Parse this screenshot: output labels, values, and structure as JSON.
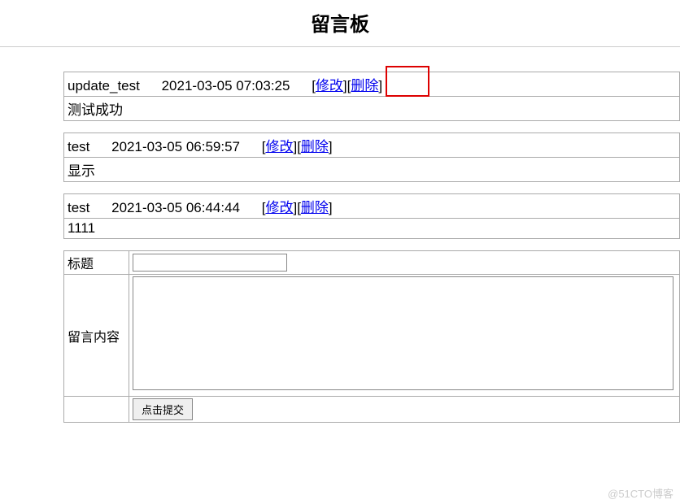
{
  "page": {
    "title": "留言板"
  },
  "messages": [
    {
      "author": "update_test",
      "datetime": "2021-03-05 07:03:25",
      "edit_label": "修改",
      "delete_label": "删除",
      "body": "测试成功",
      "highlight_delete": true
    },
    {
      "author": "test",
      "datetime": "2021-03-05 06:59:57",
      "edit_label": "修改",
      "delete_label": "删除",
      "body": "显示",
      "highlight_delete": false
    },
    {
      "author": "test",
      "datetime": "2021-03-05 06:44:44",
      "edit_label": "修改",
      "delete_label": "删除",
      "body": "1111",
      "highlight_delete": false
    }
  ],
  "form": {
    "title_label": "标题",
    "body_label": "留言内容",
    "submit_label": "点击提交"
  },
  "watermark": "@51CTO博客"
}
